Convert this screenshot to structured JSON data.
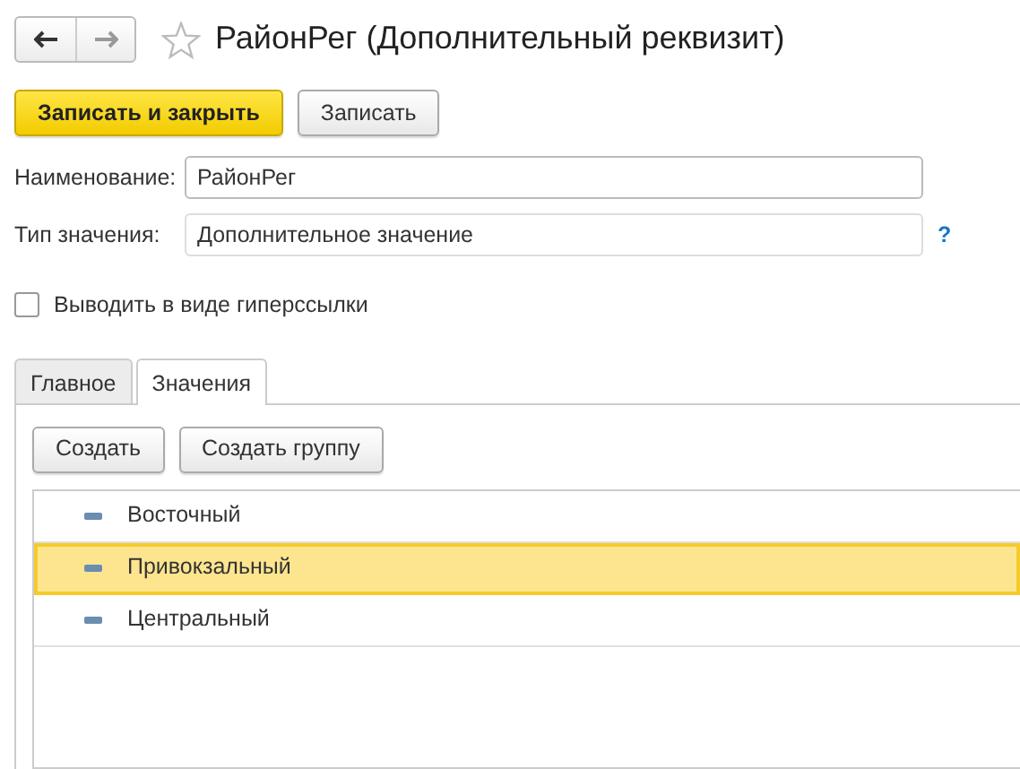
{
  "window": {
    "title": "РайонРег (Дополнительный реквизит)"
  },
  "toolbar": {
    "buttons": [
      {
        "label": "Записать и закрыть",
        "kind": "primary"
      },
      {
        "label": "Записать",
        "kind": "default"
      }
    ]
  },
  "fields": [
    {
      "label": "Наименование:",
      "value": "РайонРег"
    },
    {
      "label": "Тип значения:",
      "value": "Дополнительное значение",
      "help": "?"
    }
  ],
  "hyperlink_checkbox": {
    "label": "Выводить в виде гиперссылки",
    "checked": false
  },
  "tabs": [
    {
      "label": "Главное",
      "selected": false
    },
    {
      "label": "Значения",
      "selected": true
    }
  ],
  "values_panel": {
    "buttons": [
      "Создать",
      "Создать группу"
    ],
    "items": [
      {
        "label": "Восточный",
        "selected": false
      },
      {
        "label": "Привокзальный",
        "selected": true
      },
      {
        "label": "Центральный",
        "selected": false
      }
    ]
  }
}
